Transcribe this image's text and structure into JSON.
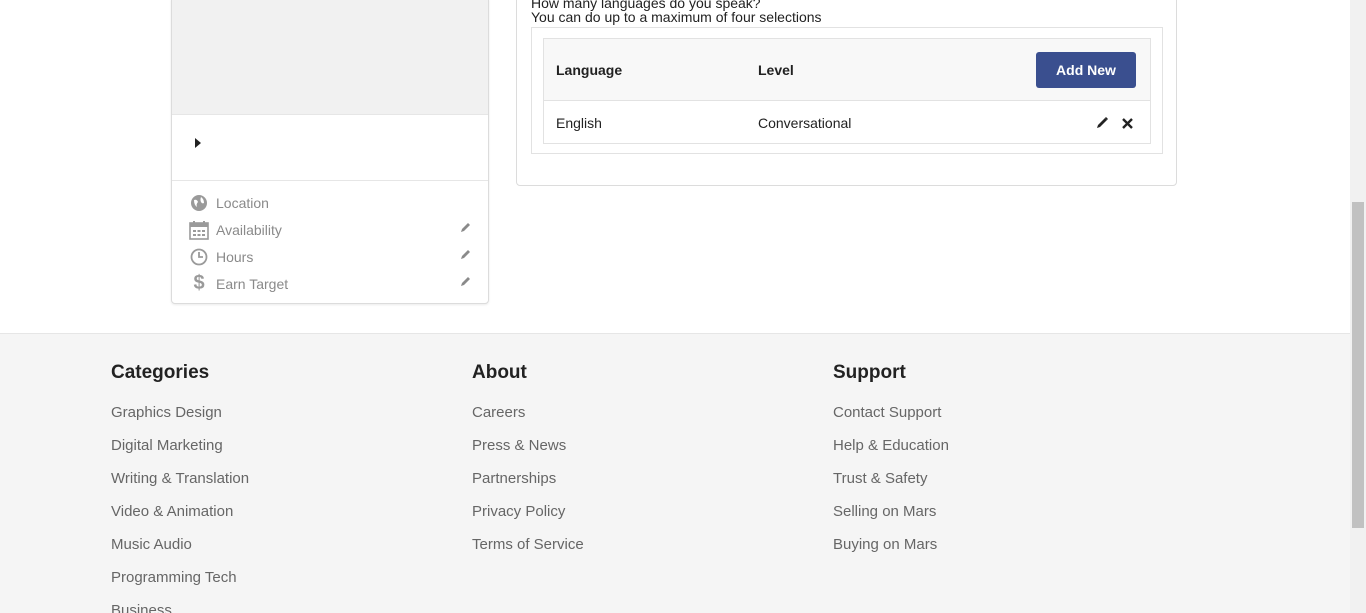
{
  "profile": {
    "info": [
      {
        "label": "Location",
        "icon": "globe-icon",
        "editable": false
      },
      {
        "label": "Availability",
        "icon": "calendar-icon",
        "editable": true
      },
      {
        "label": "Hours",
        "icon": "clock-icon",
        "editable": true
      },
      {
        "label": "Earn Target",
        "icon": "dollar-icon",
        "editable": true
      }
    ]
  },
  "languages": {
    "question": "How many languages do you speak?",
    "max_note": "You can do up to a maximum of four selections",
    "header": {
      "language": "Language",
      "level": "Level"
    },
    "add_label": "Add New",
    "rows": [
      {
        "language": "English",
        "level": "Conversational"
      }
    ]
  },
  "footer": {
    "categories": {
      "title": "Categories",
      "links": [
        "Graphics Design",
        "Digital Marketing",
        "Writing & Translation",
        "Video & Animation",
        "Music Audio",
        "Programming Tech",
        "Business"
      ]
    },
    "about": {
      "title": "About",
      "links": [
        "Careers",
        "Press & News",
        "Partnerships",
        "Privacy Policy",
        "Terms of Service"
      ]
    },
    "support": {
      "title": "Support",
      "links": [
        "Contact Support",
        "Help & Education",
        "Trust & Safety",
        "Selling on Mars",
        "Buying on Mars"
      ]
    }
  },
  "colors": {
    "primary_button": "#3a4f8f",
    "footer_bg": "#f5f5f5",
    "muted_text": "#8a8a8a"
  }
}
